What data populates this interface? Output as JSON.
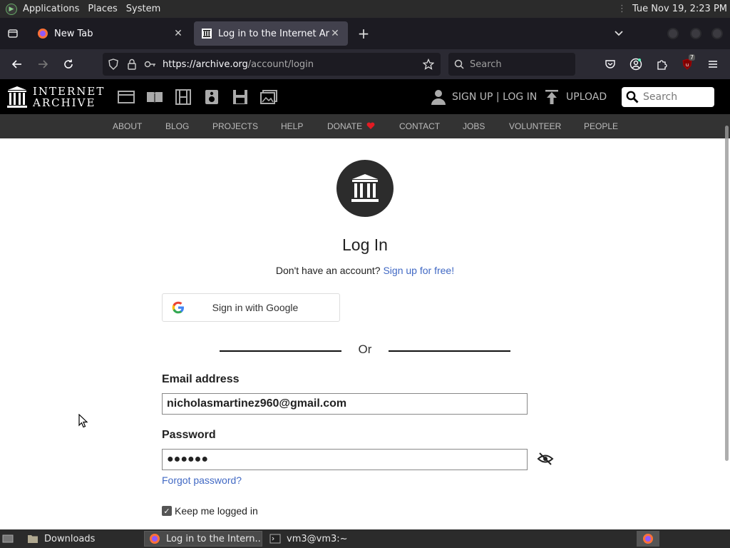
{
  "top_panel": {
    "menus": [
      "Applications",
      "Places",
      "System"
    ],
    "clock": "Tue Nov 19,  2:23 PM"
  },
  "tabs": {
    "items": [
      {
        "title": "New Tab"
      },
      {
        "title": "Log in to the Internet Archive"
      }
    ]
  },
  "nav": {
    "url_host": "https://archive.org",
    "url_path": "/account/login",
    "search_placeholder": "Search",
    "extension_badge": "7"
  },
  "ia_header": {
    "logo_line1": "INTERNET",
    "logo_line2": "ARCHIVE",
    "signup_login": "SIGN UP | LOG IN",
    "upload": "UPLOAD",
    "search_placeholder": "Search"
  },
  "subnav": {
    "items": [
      "ABOUT",
      "BLOG",
      "PROJECTS",
      "HELP",
      "DONATE",
      "CONTACT",
      "JOBS",
      "VOLUNTEER",
      "PEOPLE"
    ]
  },
  "login": {
    "title": "Log In",
    "no_account": "Don't have an account?",
    "signup_link": "Sign up for free!",
    "google_button": "Sign in with Google",
    "or": "Or",
    "email_label": "Email address",
    "email_value": "nicholasmartinez960@gmail.com",
    "password_label": "Password",
    "password_value": "●●●●●●",
    "forgot_password": "Forgot password?",
    "keep_logged_in": "Keep me logged in"
  },
  "taskbar": {
    "items": [
      "Downloads",
      "Log in to the Intern...",
      "vm3@vm3:~"
    ]
  },
  "colors": {
    "link": "#4169c4",
    "ia_black": "#000000",
    "subnav_bg": "#333333",
    "firefox_dark": "#1c1b22"
  }
}
